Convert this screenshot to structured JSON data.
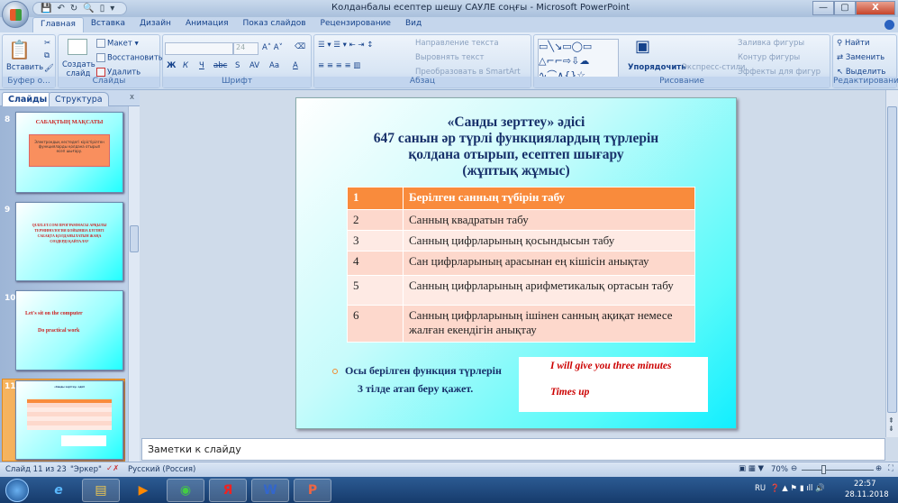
{
  "window": {
    "title": "Колданбалы есептер шешу САУЛЕ соңғы - Microsoft PowerPoint",
    "minimize": "—",
    "maximize": "▢",
    "close": "X"
  },
  "tabs": [
    {
      "label": "Главная",
      "active": true
    },
    {
      "label": "Вставка"
    },
    {
      "label": "Дизайн"
    },
    {
      "label": "Анимация"
    },
    {
      "label": "Показ слайдов"
    },
    {
      "label": "Рецензирование"
    },
    {
      "label": "Вид"
    }
  ],
  "ribbon": {
    "clipboard": {
      "label": "Буфер о...",
      "paste": "Вставить"
    },
    "slides": {
      "label": "Слайды",
      "new_slide": "Создать слайд",
      "layout": "Макет",
      "reset": "Восстановить",
      "delete": "Удалить"
    },
    "font": {
      "label": "Шрифт",
      "font_name": "",
      "font_size": "24",
      "bold": "Ж",
      "italic": "К",
      "underline": "Ч",
      "strike": "abc",
      "shadow": "S",
      "spacing": "AV",
      "case": "Aa",
      "color": "A"
    },
    "paragraph": {
      "label": "Абзац",
      "text_direction": "Направление текста",
      "align_text": "Выровнять текст",
      "smartart": "Преобразовать в SmartArt"
    },
    "drawing": {
      "label": "Рисование",
      "arrange": "Упорядочить",
      "quick_styles": "Экспресс-стили",
      "fill": "Заливка фигуры",
      "outline": "Контур фигуры",
      "effects": "Эффекты для фигур"
    },
    "editing": {
      "label": "Редактирование",
      "find": "Найти",
      "replace": "Заменить",
      "select": "Выделить"
    }
  },
  "left_panel": {
    "tab_slides": "Слайды",
    "tab_outline": "Структура",
    "close": "x",
    "thumbnails": [
      {
        "number": "8",
        "title": "САБАҚТЫҢ МАҚСАТЫ",
        "body": "Электрондық кестедегі кірістірілген функцияларды қолдана отырып есеп шығару."
      },
      {
        "number": "9",
        "body": "QUIZLET.COM ПРОГРАММАСЫ АРҚЫЛЫ ТЕРМИНОЛОГИЯ БОЙЫНША БҮГІНГІ САБАҚТА ҚОЛДАНЫЛАТЫН ЖАҢА СӨЗДЕРДІ ҚАЙТАЛАУ"
      },
      {
        "number": "10",
        "line1": "Let's sit on the computer",
        "line2": "Do practical work"
      },
      {
        "number": "11",
        "selected": true
      }
    ]
  },
  "slide": {
    "title_lines": [
      "«Санды  зерттеу» әдісі",
      "647 санын әр түрлі функциялардың  түрлерін",
      "қолдана отырып, есептеп шығару",
      "(жұптық  жұмыс)"
    ],
    "table": [
      [
        "1",
        "Берілген санның түбірін табу"
      ],
      [
        "2",
        "Санның квадратын табу"
      ],
      [
        "3",
        "Санның цифрларының қосындысын табу"
      ],
      [
        "4",
        "Сан цифрларының арасынан ең кішісін анықтау"
      ],
      [
        "5",
        "Санның цифрларының арифметикалық ортасын табу"
      ],
      [
        "6",
        "Санның  цифрларының ішінен санның ақиқат немесе жалған екендігін анықтау"
      ]
    ],
    "bullet_line1": "Осы берілген функция түрлерін",
    "bullet_line2": "3 тілде атап беру қажет.",
    "box_line1": "I will give you three  minutes",
    "box_line2": "Times up"
  },
  "notes_placeholder": "Заметки к слайду",
  "status": {
    "slide": "Слайд 11 из 23",
    "theme": "\"Эркер\"",
    "language": "Русский (Россия)",
    "zoom": "70%",
    "zoom_percent": 70
  },
  "taskbar": {
    "lang": "RU",
    "time": "22:57",
    "date": "28.11.2018"
  },
  "colors": {
    "accent": "#f98b3c",
    "title": "#17306a",
    "box_text": "#cc0000"
  }
}
